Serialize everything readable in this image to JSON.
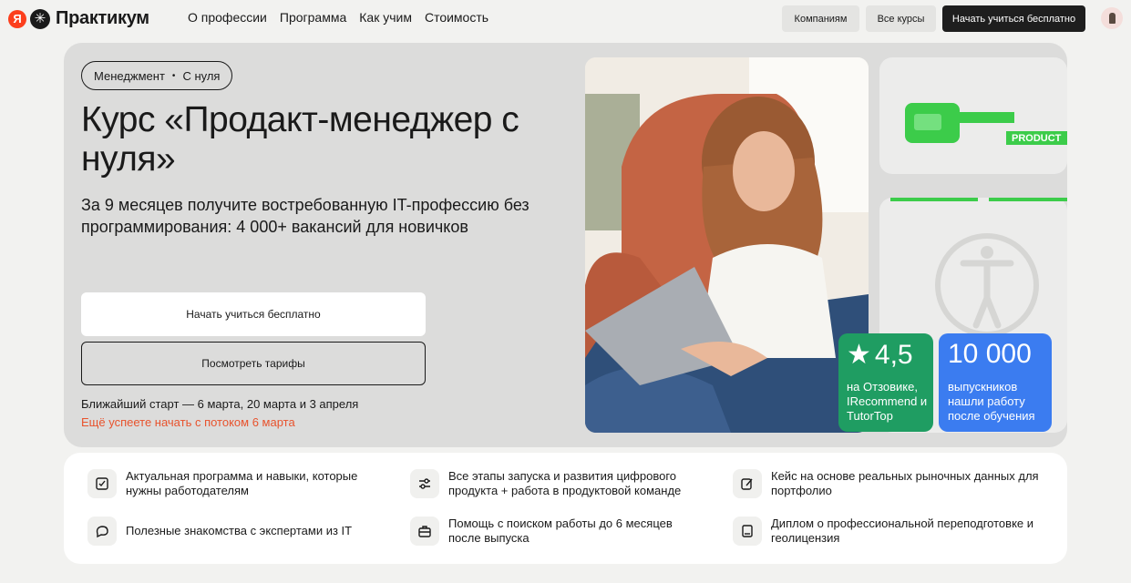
{
  "header": {
    "logo_ya": "Я",
    "logo_text": "Практикум",
    "nav": [
      "О профессии",
      "Программа",
      "Как учим",
      "Стоимость"
    ],
    "companies_label": "Компаниям",
    "all_courses_label": "Все курсы",
    "start_label": "Начать учиться бесплатно"
  },
  "hero": {
    "tag_left": "Менеджмент",
    "tag_right": "С нуля",
    "title": "Курс «Продакт-менеджер с нуля»",
    "subtitle": "За 9 месяцев получите востребованную IT-профессию без программирования: 4 000+ вакансий для новичков",
    "btn_free": "Начать учиться бесплатно",
    "btn_plans": "Посмотреть тарифы",
    "start_dates": "Ближайший старт — 6 марта, 20 марта и 3 апреля",
    "start_hint": "Ещё успеете начать с потоком 6 марта",
    "product_label": "PRODUCT"
  },
  "stats": {
    "rating_value": "4,5",
    "rating_text": "на Отзовике, IRecommend и TutorTop",
    "grads_value": "10 000",
    "grads_text": "выпускников нашли работу после обучения"
  },
  "features": [
    {
      "icon": "checkbox-icon",
      "text": "Актуальная программа и навыки, которые нужны работодателям"
    },
    {
      "icon": "sliders-icon",
      "text": "Все этапы запуска и развития цифрового продукта + работа в продуктовой команде"
    },
    {
      "icon": "edit-icon",
      "text": "Кейс на основе реальных рыночных данных для портфолио"
    },
    {
      "icon": "chat-icon",
      "text": "Полезные знакомства с экспертами из IT"
    },
    {
      "icon": "briefcase-icon",
      "text": "Помощь с поиском работы до 6 месяцев после выпуска"
    },
    {
      "icon": "diploma-icon",
      "text": "Диплом о профессиональной переподготовке и геолицензия"
    }
  ],
  "colors": {
    "accent_orange": "#e8532d",
    "rating_green": "#1f9d62",
    "grads_blue": "#3b7cf0",
    "product_green": "#3ccc4a"
  }
}
